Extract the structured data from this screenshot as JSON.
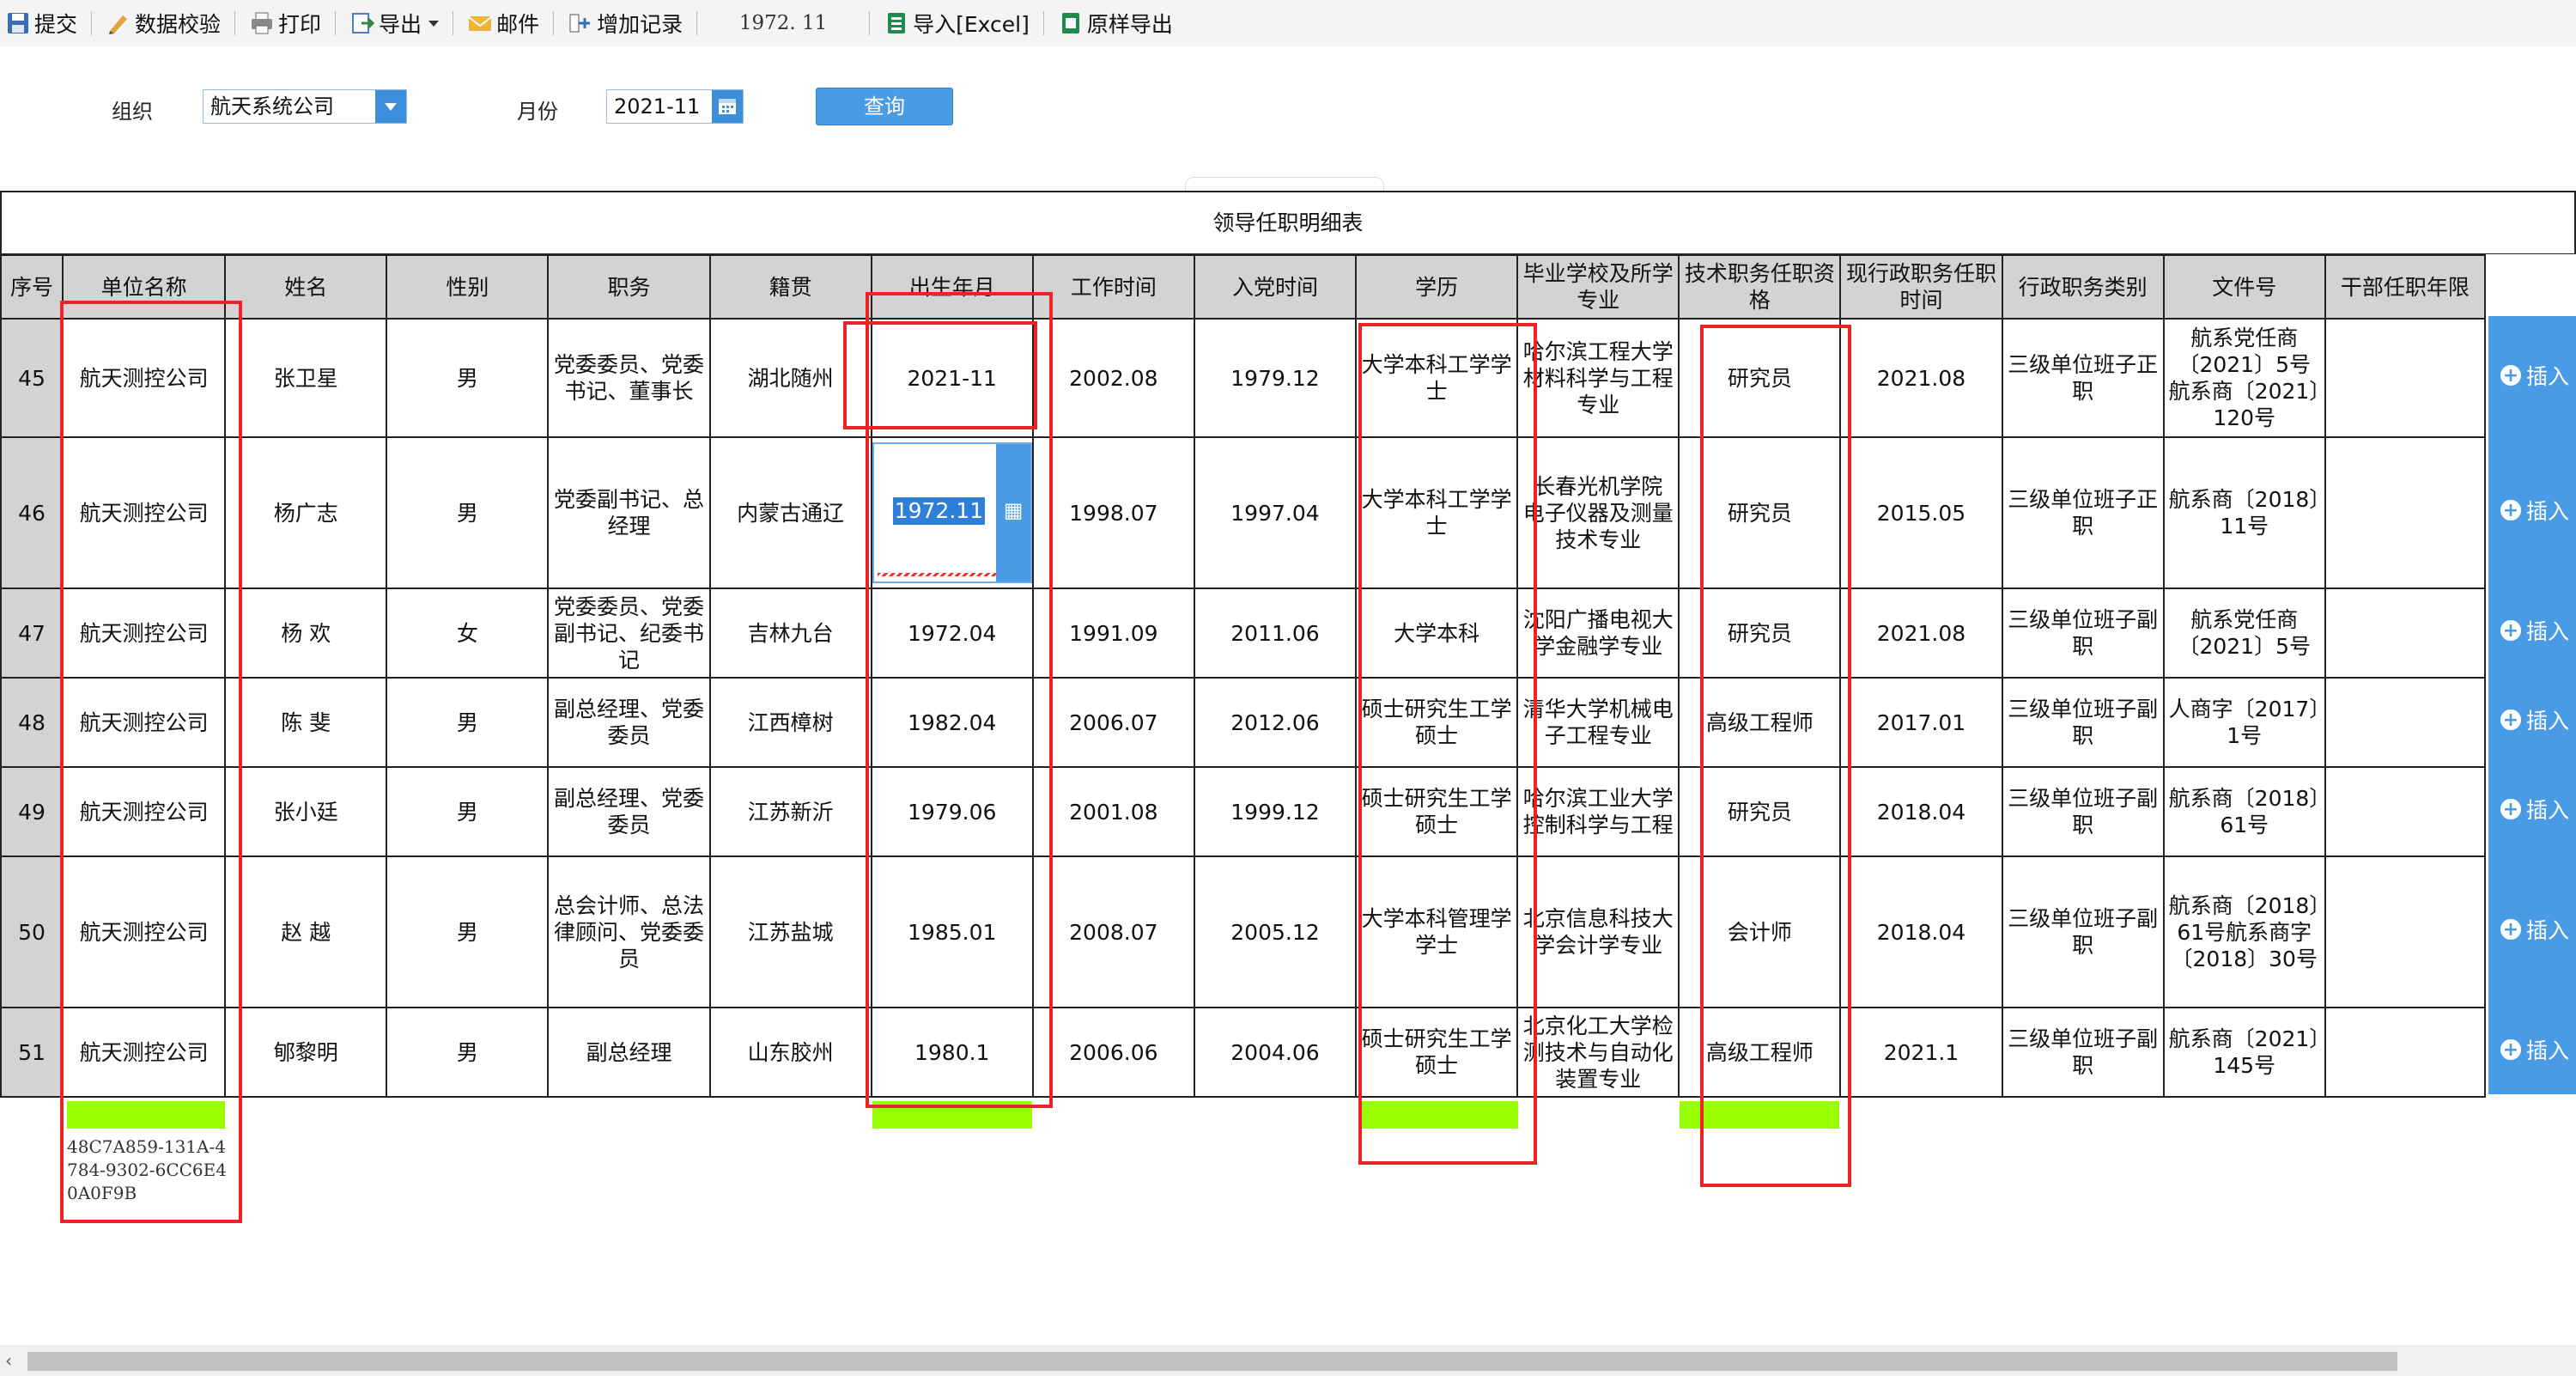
{
  "toolbar": {
    "submit": "提交",
    "validate": "数据校验",
    "print": "打印",
    "export": "导出",
    "mail": "邮件",
    "add_record": "增加记录",
    "current_value": "1972. 11",
    "import_excel": "导入[Excel]",
    "template_export": "原样导出"
  },
  "query": {
    "org_label": "组织",
    "org_value": "航天系统公司",
    "month_label": "月份",
    "month_value": "2021-11",
    "query_button": "查询"
  },
  "report": {
    "title": "领导任职明细表",
    "headers": [
      "序号",
      "单位名称",
      "姓名",
      "性别",
      "职务",
      "籍贯",
      "出生年月",
      "工作时间",
      "入党时间",
      "学历",
      "毕业学校及所学专业",
      "技术职务任职资格",
      "现行政职务任职时间",
      "行政职务类别",
      "文件号",
      "干部任职年限"
    ],
    "insert_label": "插入"
  },
  "rows": [
    {
      "seq": "45",
      "unit": "航天测控公司",
      "name": "张卫星",
      "gender": "男",
      "duty": "党委委员、党委书记、董事长",
      "origin": "湖北随州",
      "birth": "2021-11",
      "work": "2002.08",
      "party": "1979.12",
      "edu": "大学本科工学学士",
      "school": "哈尔滨工程大学材料科学与工程专业",
      "tech": "研究员",
      "admin_time": "2021.08",
      "admin_type": "三级单位班子正职",
      "doc": "航系党任商〔2021〕5号航系商〔2021〕120号",
      "years": ""
    },
    {
      "seq": "46",
      "unit": "航天测控公司",
      "name": "杨广志",
      "gender": "男",
      "duty": "党委副书记、总经理",
      "origin": "内蒙古通辽",
      "birth": "1972.11",
      "work": "1998.07",
      "party": "1997.04",
      "edu": "大学本科工学学士",
      "school": "长春光机学院 电子仪器及测量技术专业",
      "tech": "研究员",
      "admin_time": "2015.05",
      "admin_type": "三级单位班子正职",
      "doc": "航系商〔2018〕11号",
      "years": ""
    },
    {
      "seq": "47",
      "unit": "航天测控公司",
      "name": "杨 欢",
      "gender": "女",
      "duty": "党委委员、党委副书记、纪委书记",
      "origin": "吉林九台",
      "birth": "1972.04",
      "work": "1991.09",
      "party": "2011.06",
      "edu": "大学本科",
      "school": "沈阳广播电视大学金融学专业",
      "tech": "研究员",
      "admin_time": "2021.08",
      "admin_type": "三级单位班子副职",
      "doc": "航系党任商〔2021〕5号",
      "years": ""
    },
    {
      "seq": "48",
      "unit": "航天测控公司",
      "name": "陈 斐",
      "gender": "男",
      "duty": "副总经理、党委委员",
      "origin": "江西樟树",
      "birth": "1982.04",
      "work": "2006.07",
      "party": "2012.06",
      "edu": "硕士研究生工学硕士",
      "school": "清华大学机械电子工程专业",
      "tech": "高级工程师",
      "admin_time": "2017.01",
      "admin_type": "三级单位班子副职",
      "doc": "人商字〔2017〕1号",
      "years": ""
    },
    {
      "seq": "49",
      "unit": "航天测控公司",
      "name": "张小廷",
      "gender": "男",
      "duty": "副总经理、党委委员",
      "origin": "江苏新沂",
      "birth": "1979.06",
      "work": "2001.08",
      "party": "1999.12",
      "edu": "硕士研究生工学硕士",
      "school": "哈尔滨工业大学控制科学与工程",
      "tech": "研究员",
      "admin_time": "2018.04",
      "admin_type": "三级单位班子副职",
      "doc": "航系商〔2018〕61号",
      "years": ""
    },
    {
      "seq": "50",
      "unit": "航天测控公司",
      "name": "赵 越",
      "gender": "男",
      "duty": "总会计师、总法律顾问、党委委员",
      "origin": "江苏盐城",
      "birth": "1985.01",
      "work": "2008.07",
      "party": "2005.12",
      "edu": "大学本科管理学学士",
      "school": "北京信息科技大学会计学专业",
      "tech": "会计师",
      "admin_time": "2018.04",
      "admin_type": "三级单位班子副职",
      "doc": "航系商〔2018〕61号航系商字〔2018〕30号",
      "years": ""
    },
    {
      "seq": "51",
      "unit": "航天测控公司",
      "name": "郇黎明",
      "gender": "男",
      "duty": "副总经理",
      "origin": "山东胶州",
      "birth": "1980.1",
      "work": "2006.06",
      "party": "2004.06",
      "edu": "硕士研究生工学硕士",
      "school": "北京化工大学检测技术与自动化装置专业",
      "tech": "高级工程师",
      "admin_time": "2021.1",
      "admin_type": "三级单位班子副职",
      "doc": "航系商〔2021〕145号",
      "years": ""
    }
  ],
  "footer_hash": "48C7A859-131A-4784-9302-6CC6E40A0F9B",
  "colors": {
    "accent": "#4a9be6",
    "highlight_green": "#99ff00",
    "annotation_red": "#ee2222",
    "header_gray": "#d3d3d3"
  }
}
